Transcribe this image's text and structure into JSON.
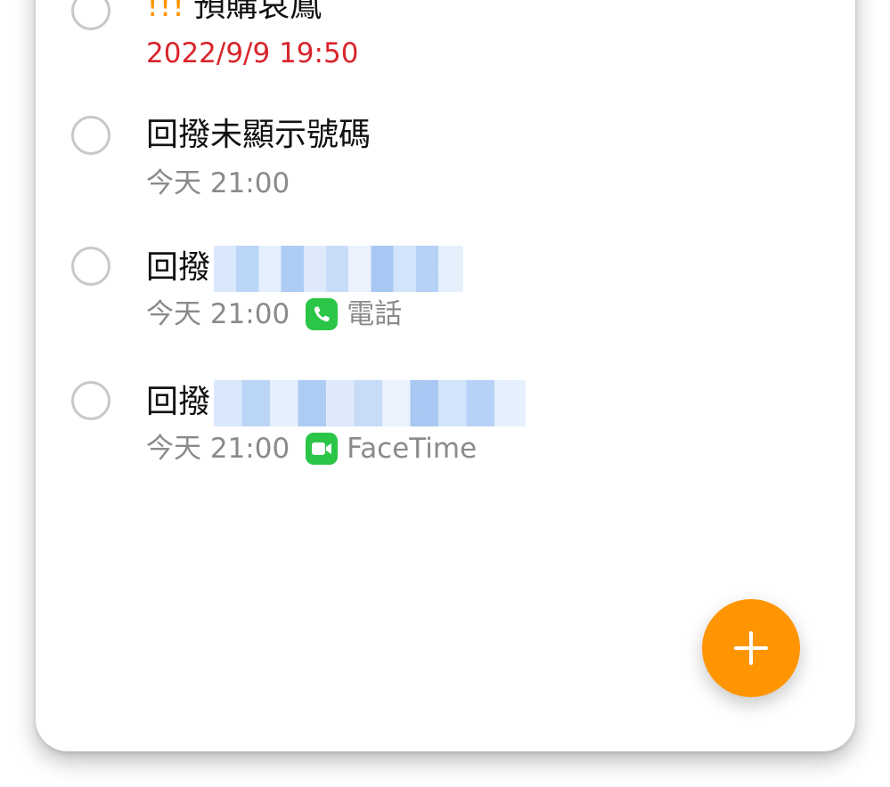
{
  "reminders": [
    {
      "priority": "!!!",
      "title": "預購哀鳳",
      "due": "2022/9/9 19:50",
      "overdue": true
    },
    {
      "title": "回撥未顯示號碼",
      "due": "今天 21:00"
    },
    {
      "title": "回撥",
      "due": "今天 21:00",
      "app_label": "電話",
      "app_icon": "phone-app-icon"
    },
    {
      "title": "回撥",
      "due": "今天 21:00",
      "app_label": "FaceTime",
      "app_icon": "facetime-app-icon"
    }
  ],
  "colors": {
    "accent": "#ff9500",
    "overdue": "#d9242b",
    "app_green": "#2bc548"
  },
  "fab": {
    "icon": "plus-icon"
  }
}
